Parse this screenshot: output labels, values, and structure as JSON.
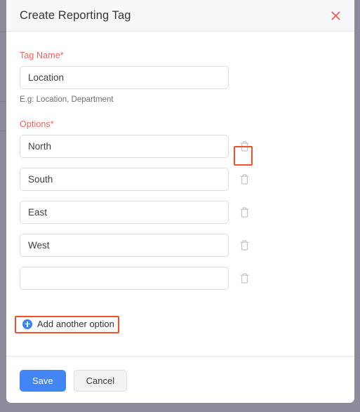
{
  "window": {
    "background_color": "#8b8b9b"
  },
  "modal": {
    "title": "Create Reporting Tag",
    "close_icon": "close-icon",
    "accent_color": "#4285f4",
    "required_label_color": "#f4625c",
    "annotation_color": "#f4502a"
  },
  "tag_name": {
    "label": "Tag Name*",
    "value": "Location",
    "placeholder": "",
    "hint": "E.g: Location, Department"
  },
  "options": {
    "label": "Options*",
    "rows": [
      {
        "value": "North",
        "placeholder": "",
        "delete_icon": "trash-icon",
        "highlighted": true
      },
      {
        "value": "South",
        "placeholder": "",
        "delete_icon": "trash-icon",
        "highlighted": false
      },
      {
        "value": "East",
        "placeholder": "",
        "delete_icon": "trash-icon",
        "highlighted": false
      },
      {
        "value": "West",
        "placeholder": "",
        "delete_icon": "trash-icon",
        "highlighted": false
      },
      {
        "value": "",
        "placeholder": "",
        "delete_icon": "trash-icon",
        "highlighted": false
      }
    ],
    "add_option": {
      "label": "Add another option",
      "icon": "plus-circle-icon",
      "icon_color": "#3b82f6",
      "highlighted": true
    }
  },
  "footer": {
    "save_label": "Save",
    "cancel_label": "Cancel"
  }
}
